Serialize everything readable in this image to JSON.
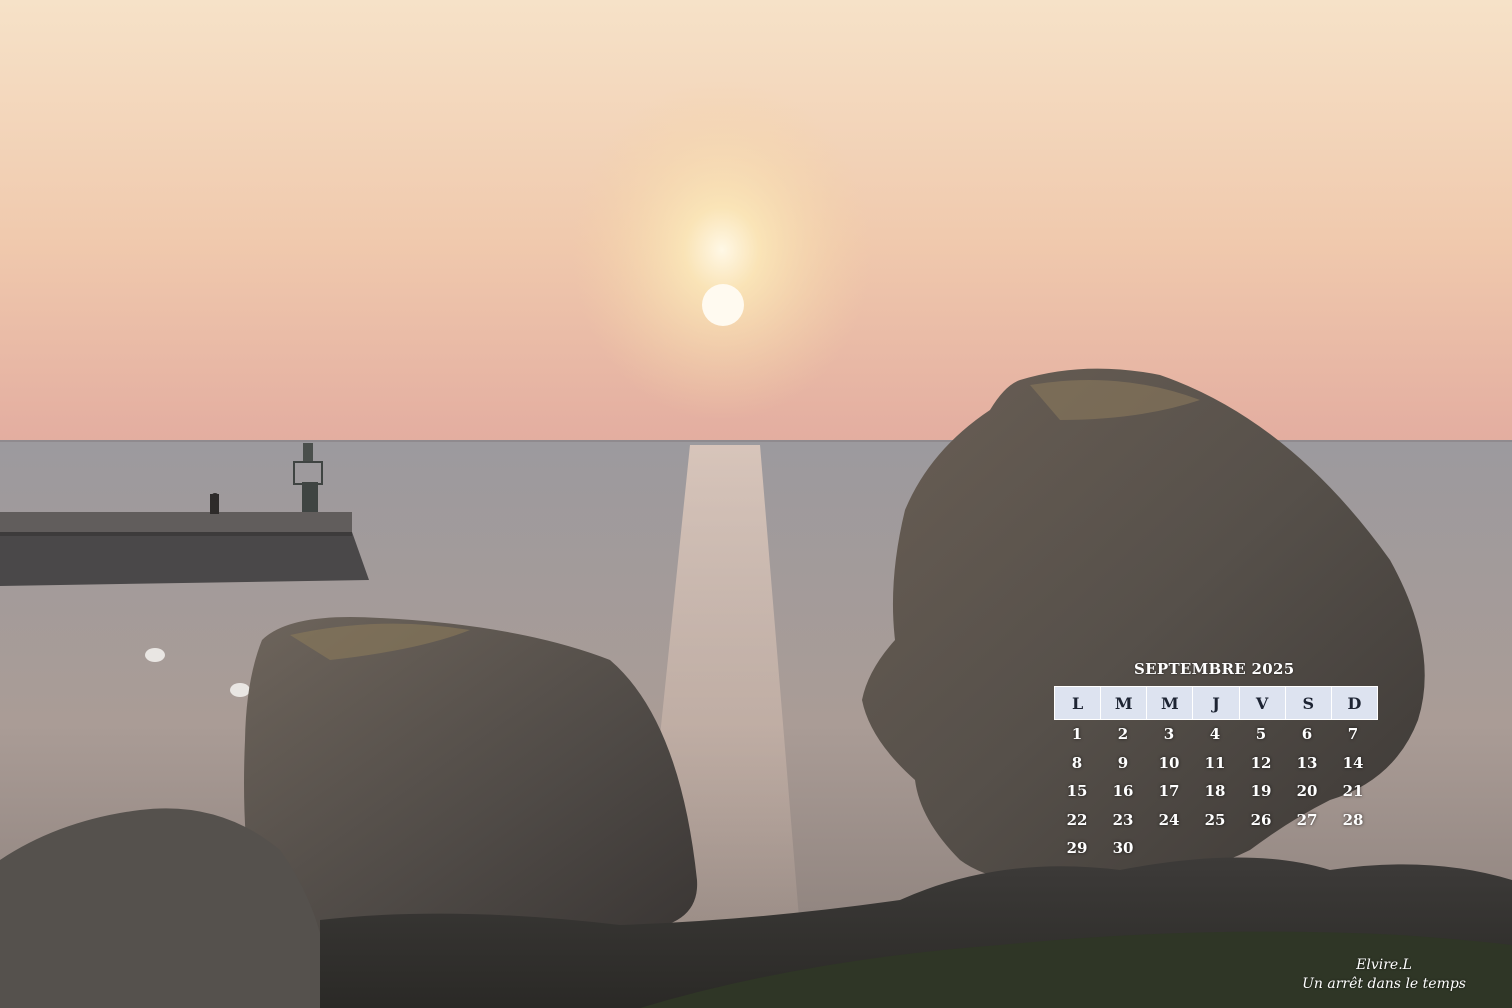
{
  "calendar": {
    "title": "SEPTEMBRE  2025",
    "weekdays": [
      "L",
      "M",
      "M",
      "J",
      "V",
      "S",
      "D"
    ],
    "weeks": [
      [
        "1",
        "2",
        "3",
        "4",
        "5",
        "6",
        "7"
      ],
      [
        "8",
        "9",
        "10",
        "11",
        "12",
        "13",
        "14"
      ],
      [
        "15",
        "16",
        "17",
        "18",
        "19",
        "20",
        "21"
      ],
      [
        "22",
        "23",
        "24",
        "25",
        "26",
        "27",
        "28"
      ],
      [
        "29",
        "30",
        "",
        "",
        "",
        "",
        ""
      ]
    ]
  },
  "signature": {
    "name": "Elvire.L",
    "tagline": "Un arrêt dans le temps"
  },
  "colors": {
    "sky_top": "#f4dcc2",
    "sky_horizon": "#e6b4a2",
    "sea": "#b7a49a",
    "rock": "#5f5a55",
    "header_bg": "#dde3f0"
  }
}
